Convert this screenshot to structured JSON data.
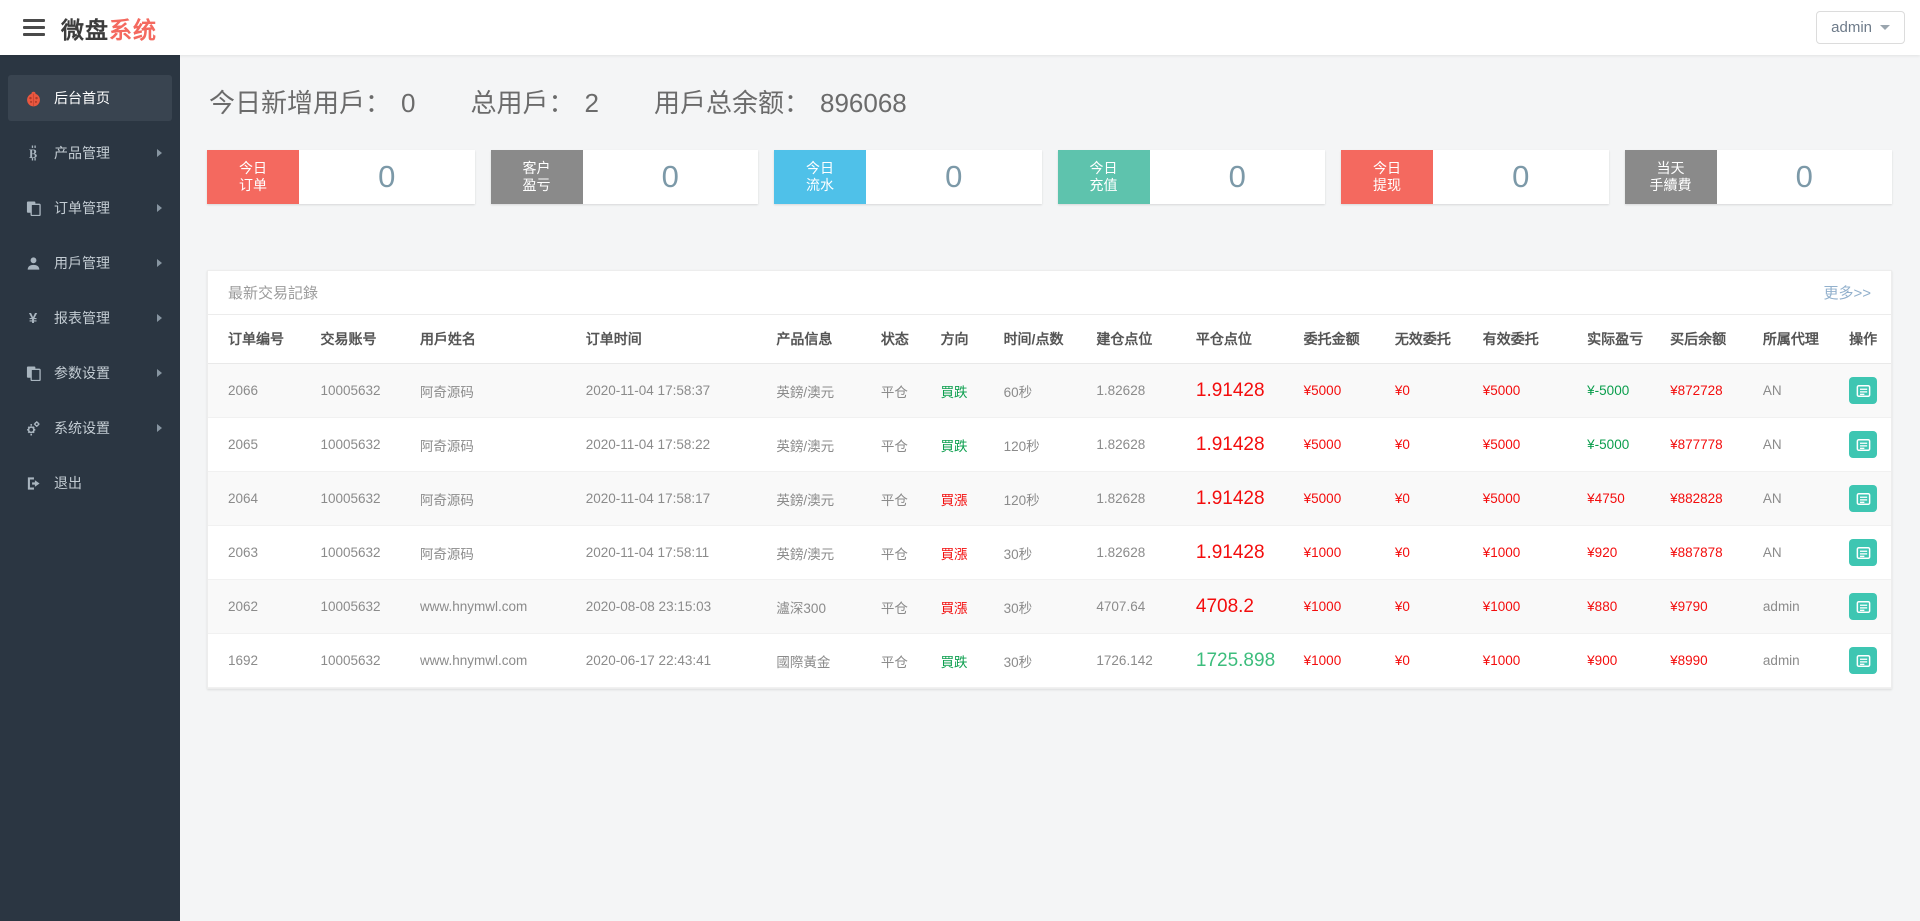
{
  "topbar": {
    "logo": {
      "primary": "微盘",
      "accent": "系统"
    },
    "user_dropdown": {
      "label": "admin"
    }
  },
  "sidebar": {
    "items": [
      {
        "name": "dashboard-home",
        "label": "后台首页",
        "icon": "dashboard-icon",
        "active": true,
        "has_submenu": false
      },
      {
        "name": "product-management",
        "label": "产品管理",
        "icon": "bitcoin-icon",
        "active": false,
        "has_submenu": true
      },
      {
        "name": "order-management",
        "label": "订单管理",
        "icon": "files-icon",
        "active": false,
        "has_submenu": true
      },
      {
        "name": "user-management",
        "label": "用戶管理",
        "icon": "user-icon",
        "active": false,
        "has_submenu": true
      },
      {
        "name": "report-management",
        "label": "报表管理",
        "icon": "yen-icon",
        "active": false,
        "has_submenu": true
      },
      {
        "name": "parameter-settings",
        "label": "参数设置",
        "icon": "files-icon",
        "active": false,
        "has_submenu": true
      },
      {
        "name": "system-settings",
        "label": "系统设置",
        "icon": "gears-icon",
        "active": false,
        "has_submenu": true
      },
      {
        "name": "logout",
        "label": "退出",
        "icon": "signout-icon",
        "active": false,
        "has_submenu": false
      }
    ]
  },
  "summary": {
    "stats": [
      {
        "label": "今日新增用戶：",
        "value": "0"
      },
      {
        "label": "总用戶：",
        "value": "2"
      },
      {
        "label": "用戶总余额：",
        "value": "896068"
      }
    ]
  },
  "cards": [
    {
      "label": "今日\n订单",
      "value": "0",
      "color": "#f4695f"
    },
    {
      "label": "客户\n盈亏",
      "value": "0",
      "color": "#8a8a8a"
    },
    {
      "label": "今日\n流水",
      "value": "0",
      "color": "#4fc1e9"
    },
    {
      "label": "今日\n充值",
      "value": "0",
      "color": "#5ec3ad"
    },
    {
      "label": "今日\n提现",
      "value": "0",
      "color": "#f4695f"
    },
    {
      "label": "当天\n手續費",
      "value": "0",
      "color": "#8a8a8a"
    }
  ],
  "panel": {
    "title": "最新交易記錄",
    "more_link": "更多>>"
  },
  "table": {
    "columns": [
      "订单编号",
      "交易账号",
      "用戶姓名",
      "订单时间",
      "产品信息",
      "状态",
      "方向",
      "时间/点数",
      "建仓点位",
      "平仓点位",
      "委托金额",
      "无效委托",
      "有效委托",
      "实际盈亏",
      "买后余额",
      "所属代理",
      "操作"
    ],
    "action_icon": "list-icon",
    "rows": [
      {
        "cells": [
          "2066",
          "10005632",
          "阿奇源码",
          "2020-11-04 17:58:37",
          "英鎊/澳元",
          "平仓",
          "買跌",
          "60秒",
          "1.82628",
          "1.91428",
          "¥5000",
          "¥0",
          "¥5000",
          "¥-5000",
          "¥872728",
          "AN"
        ],
        "colors": {
          "6": "green",
          "9": "red",
          "10": "red",
          "11": "red",
          "12": "red",
          "13": "green",
          "14": "red"
        }
      },
      {
        "cells": [
          "2065",
          "10005632",
          "阿奇源码",
          "2020-11-04 17:58:22",
          "英鎊/澳元",
          "平仓",
          "買跌",
          "120秒",
          "1.82628",
          "1.91428",
          "¥5000",
          "¥0",
          "¥5000",
          "¥-5000",
          "¥877778",
          "AN"
        ],
        "colors": {
          "6": "green",
          "9": "red",
          "10": "red",
          "11": "red",
          "12": "red",
          "13": "green",
          "14": "red"
        }
      },
      {
        "cells": [
          "2064",
          "10005632",
          "阿奇源码",
          "2020-11-04 17:58:17",
          "英鎊/澳元",
          "平仓",
          "買漲",
          "120秒",
          "1.82628",
          "1.91428",
          "¥5000",
          "¥0",
          "¥5000",
          "¥4750",
          "¥882828",
          "AN"
        ],
        "colors": {
          "6": "red",
          "9": "red",
          "10": "red",
          "11": "red",
          "12": "red",
          "13": "red",
          "14": "red"
        }
      },
      {
        "cells": [
          "2063",
          "10005632",
          "阿奇源码",
          "2020-11-04 17:58:11",
          "英鎊/澳元",
          "平仓",
          "買漲",
          "30秒",
          "1.82628",
          "1.91428",
          "¥1000",
          "¥0",
          "¥1000",
          "¥920",
          "¥887878",
          "AN"
        ],
        "colors": {
          "6": "red",
          "9": "red",
          "10": "red",
          "11": "red",
          "12": "red",
          "13": "red",
          "14": "red"
        }
      },
      {
        "cells": [
          "2062",
          "10005632",
          "www.hnymwl.com",
          "2020-08-08 23:15:03",
          "瀘深300",
          "平仓",
          "買漲",
          "30秒",
          "4707.64",
          "4708.2",
          "¥1000",
          "¥0",
          "¥1000",
          "¥880",
          "¥9790",
          "admin"
        ],
        "colors": {
          "6": "red",
          "9": "red",
          "10": "red",
          "11": "red",
          "12": "red",
          "13": "red",
          "14": "red"
        }
      },
      {
        "cells": [
          "1692",
          "10005632",
          "www.hnymwl.com",
          "2020-06-17 22:43:41",
          "國際黃金",
          "平仓",
          "買跌",
          "30秒",
          "1726.142",
          "1725.898",
          "¥1000",
          "¥0",
          "¥1000",
          "¥900",
          "¥8990",
          "admin"
        ],
        "colors": {
          "6": "green",
          "9": "green2",
          "10": "red",
          "11": "red",
          "12": "red",
          "13": "red",
          "14": "red"
        }
      }
    ]
  },
  "colors": {
    "accent": "#f4695f",
    "red": "#f30d0d",
    "green": "#0b9e4d",
    "green2": "#3dbd7d",
    "teal": "#3ec6b2",
    "blue_link": "#92b0cc"
  }
}
